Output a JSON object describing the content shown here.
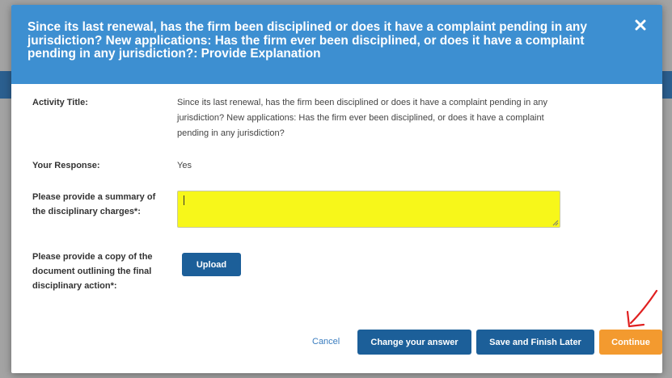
{
  "modal": {
    "title": "Since its last renewal, has the firm been disciplined or does it have a complaint pending in any jurisdiction? New applications: Has the firm ever been disciplined, or does it have a complaint pending in any jurisdiction?: Provide Explanation",
    "close_icon": "close-x-icon"
  },
  "fields": {
    "activity_title_label": "Activity Title:",
    "activity_title_value_line1": "Since its last renewal, has the firm been disciplined or does it have a complaint pending in any",
    "activity_title_value_line2": "jurisdiction? New applications: Has the firm ever been disciplined, or does it have a complaint",
    "activity_title_value_line3": "pending in any jurisdiction?",
    "response_label": "Your Response:",
    "response_value": "Yes",
    "summary_label_line1": "Please provide a summary of",
    "summary_label_line2": "the disciplinary charges*:",
    "summary_value": "",
    "document_label_line1": "Please provide a copy of the",
    "document_label_line2": "document outlining the final",
    "document_label_line3": "disciplinary action*:"
  },
  "buttons": {
    "upload": "Upload",
    "cancel": "Cancel",
    "change_answer": "Change your answer",
    "save_finish_later": "Save and Finish Later",
    "continue": "Continue"
  },
  "colors": {
    "header": "#3d8fd1",
    "primary_button": "#1c5f99",
    "continue_button": "#f39a2f",
    "highlight": "#f7f71a",
    "annotation_arrow": "#e02020"
  }
}
